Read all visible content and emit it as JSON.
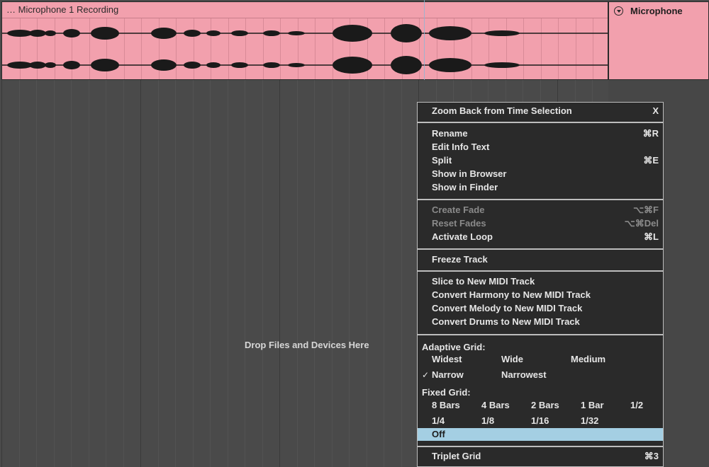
{
  "clip": {
    "title": "… Microphone 1 Recording",
    "color": "#f2a0ad"
  },
  "track": {
    "name": "Microphone"
  },
  "arrangement": {
    "drop_text": "Drop Files and Devices Here"
  },
  "context_menu": {
    "zoom_back": {
      "label": "Zoom Back from Time Selection",
      "shortcut": "X"
    },
    "rename": {
      "label": "Rename",
      "shortcut": "⌘R"
    },
    "edit_info": {
      "label": "Edit Info Text"
    },
    "split": {
      "label": "Split",
      "shortcut": "⌘E"
    },
    "show_browser": {
      "label": "Show in Browser"
    },
    "show_finder": {
      "label": "Show in Finder"
    },
    "create_fade": {
      "label": "Create Fade",
      "shortcut": "⌥⌘F"
    },
    "reset_fades": {
      "label": "Reset Fades",
      "shortcut": "⌥⌘Del"
    },
    "activate_loop": {
      "label": "Activate Loop",
      "shortcut": "⌘L"
    },
    "freeze_track": {
      "label": "Freeze Track"
    },
    "slice_midi": {
      "label": "Slice to New MIDI Track"
    },
    "convert_harmony": {
      "label": "Convert Harmony to New MIDI Track"
    },
    "convert_melody": {
      "label": "Convert Melody to New MIDI Track"
    },
    "convert_drums": {
      "label": "Convert Drums to New MIDI Track"
    },
    "adaptive_grid": {
      "header": "Adaptive Grid:",
      "widest": "Widest",
      "wide": "Wide",
      "medium": "Medium",
      "narrow": "Narrow",
      "narrowest": "Narrowest",
      "checked_mark": "✓"
    },
    "fixed_grid": {
      "header": "Fixed Grid:",
      "bars8": "8 Bars",
      "bars4": "4 Bars",
      "bars2": "2 Bars",
      "bar1": "1 Bar",
      "half": "1/2",
      "quarter": "1/4",
      "eighth": "1/8",
      "sixteenth": "1/16",
      "thirtysecond": "1/32",
      "off": "Off"
    },
    "triplet_grid": {
      "label": "Triplet Grid",
      "shortcut": "⌘3"
    },
    "highlight_color": "#a4cfe3"
  }
}
